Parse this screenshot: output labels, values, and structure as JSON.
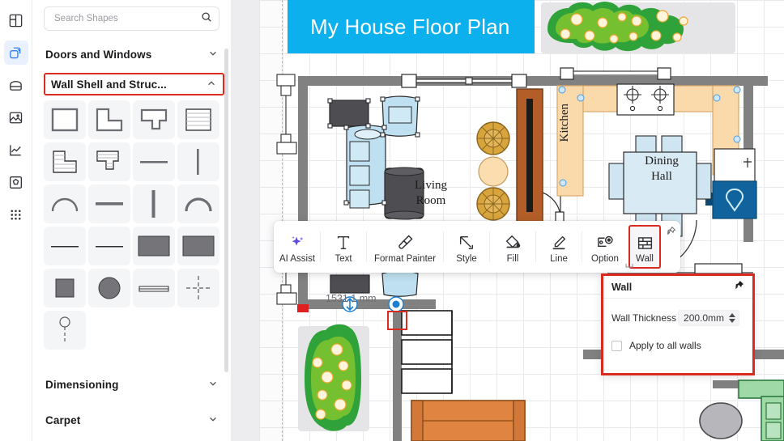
{
  "app": {
    "name": "floor-plan-editor"
  },
  "rail": {
    "items": [
      {
        "name": "layout-icon",
        "label": "Layout",
        "active": false
      },
      {
        "name": "shapes-icon",
        "label": "Shapes",
        "active": true
      },
      {
        "name": "toolbox-icon",
        "label": "Toolbox",
        "active": false
      },
      {
        "name": "image-icon",
        "label": "Image",
        "active": false
      },
      {
        "name": "chart-icon",
        "label": "Chart",
        "active": false
      },
      {
        "name": "symbol-icon",
        "label": "Symbol",
        "active": false
      },
      {
        "name": "apps-grid-icon",
        "label": "More",
        "active": false
      }
    ]
  },
  "shapes_panel": {
    "search": {
      "placeholder": "Search Shapes",
      "value": "",
      "icon": "search-icon"
    },
    "sections": [
      {
        "title": "Doors and Windows",
        "expanded": false,
        "chevron": "chevron-down-icon",
        "highlighted": false
      },
      {
        "title": "Wall Shell and Struc...",
        "expanded": true,
        "chevron": "chevron-up-icon",
        "highlighted": true
      },
      {
        "title": "Dimensioning",
        "expanded": false,
        "chevron": "chevron-down-icon",
        "highlighted": false
      },
      {
        "title": "Carpet",
        "expanded": false,
        "chevron": "chevron-down-icon",
        "highlighted": false
      }
    ],
    "shape_items": [
      "square-room",
      "l-shaped-room",
      "t-shaped-room",
      "hatched-square-room",
      "hatched-l-room",
      "hatched-t-room",
      "horizontal-wall",
      "vertical-wall",
      "arc-wall-left",
      "thick-horizontal-wall",
      "thick-vertical-wall",
      "arc-wall-right",
      "thin-horizontal-wall-1",
      "thin-horizontal-wall-2",
      "filled-rect-wall-1",
      "filled-rect-wall-2",
      "filled-square",
      "filled-circle",
      "double-line-wall",
      "center-cross-marker",
      "column-marker"
    ]
  },
  "canvas": {
    "document_title": "My House Floor Plan",
    "title_color": "#0cb0ec",
    "rooms": [
      {
        "name": "living-room-label",
        "label": "Living\nRoom",
        "line1": "Living",
        "line2": "Room"
      },
      {
        "name": "kitchen-label",
        "label": "Kitchen"
      },
      {
        "name": "dining-hall-label",
        "label": "Dining\nHall",
        "line1": "Dining",
        "line2": "Hall"
      }
    ],
    "dimension_label": "1531.1 mm",
    "selected_wall_handle": "wall-endpoint-handle",
    "colors": {
      "wall": "#818181",
      "furniture_blue": "#bfe0f0",
      "furniture_gray": "#4e4e52",
      "cabinet_tan": "#fad9ab",
      "door_wood": "#b35e28",
      "sofa_orange": "#df8441",
      "plant_green": "#3cb034",
      "sofa_green": "#9fd9a8",
      "sofa_blue": "#3a7fd5",
      "sink_blue": "#10639c"
    }
  },
  "context_toolbar": {
    "items": [
      {
        "name": "ai-assist-button",
        "label": "AI Assist",
        "icon": "sparkle-icon",
        "selected": false
      },
      {
        "name": "text-button",
        "label": "Text",
        "icon": "text-t-icon",
        "selected": false
      },
      {
        "name": "format-painter-button",
        "label": "Format Painter",
        "icon": "paintbrush-icon",
        "selected": false
      },
      {
        "name": "style-button",
        "label": "Style",
        "icon": "style-pen-icon",
        "selected": false
      },
      {
        "name": "fill-button",
        "label": "Fill",
        "icon": "paint-bucket-icon",
        "selected": false
      },
      {
        "name": "line-button",
        "label": "Line",
        "icon": "line-pen-icon",
        "selected": false
      },
      {
        "name": "option-button",
        "label": "Option",
        "icon": "option-gear-icon",
        "selected": false
      },
      {
        "name": "wall-button",
        "label": "Wall",
        "icon": "brick-wall-icon",
        "selected": true
      }
    ],
    "pin_icon": "pin-icon",
    "selection_color": "#d92b20"
  },
  "wall_dialog": {
    "title": "Wall",
    "pin_icon": "pin-icon",
    "thickness_label": "Wall Thickness",
    "thickness_value": "200.0mm",
    "stepper_icon": "stepper-arrows-icon",
    "apply_all_label": "Apply to all walls",
    "apply_all_checked": false,
    "border_color": "#d92b20"
  }
}
